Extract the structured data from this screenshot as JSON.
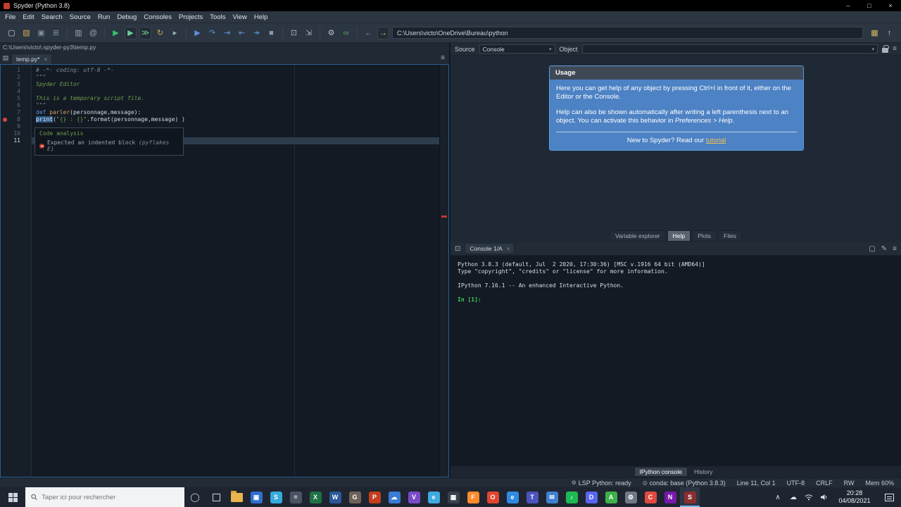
{
  "titlebar": {
    "title": "Spyder (Python 3.8)",
    "minimize_glyph": "–",
    "maximize_glyph": "□",
    "close_glyph": "×"
  },
  "menubar": {
    "items": [
      "File",
      "Edit",
      "Search",
      "Source",
      "Run",
      "Debug",
      "Consoles",
      "Projects",
      "Tools",
      "View",
      "Help"
    ]
  },
  "toolbar": {
    "path_value": "C:\\Users\\victo\\OneDrive\\Bureau\\python",
    "icons": [
      {
        "name": "new-file-icon",
        "g": "▢",
        "c": "#c8d1da"
      },
      {
        "name": "open-file-icon",
        "g": "▧",
        "c": "#d0aa54"
      },
      {
        "name": "save-icon",
        "g": "▣",
        "c": "#7f8da0"
      },
      {
        "name": "save-all-icon",
        "g": "⊞",
        "c": "#7f8da0"
      },
      {
        "sep": true
      },
      {
        "name": "create-cell-icon",
        "g": "▥",
        "c": "#9aa7b5"
      },
      {
        "name": "find-icon",
        "g": "@",
        "c": "#9aa7b5"
      },
      {
        "sep": true
      },
      {
        "name": "run-file-icon",
        "g": "▶",
        "c": "#37c26e"
      },
      {
        "name": "run-cell-icon",
        "g": "▶",
        "c": "#68cf93",
        "boxed": true
      },
      {
        "name": "run-cell-advance-icon",
        "g": "≫",
        "c": "#68cf93",
        "boxed": true
      },
      {
        "name": "rerun-cell-icon",
        "g": "↻",
        "c": "#cfae4a"
      },
      {
        "name": "run-selection-icon",
        "g": "▸",
        "c": "#9ab0c4"
      },
      {
        "sep": true
      },
      {
        "name": "debug-file-icon",
        "g": "▶",
        "c": "#5c8fd6"
      },
      {
        "name": "step-over-icon",
        "g": "↷",
        "c": "#5c8fd6"
      },
      {
        "name": "step-into-icon",
        "g": "⇥",
        "c": "#5c8fd6"
      },
      {
        "name": "step-out-icon",
        "g": "⇤",
        "c": "#5c8fd6"
      },
      {
        "name": "continue-icon",
        "g": "↠",
        "c": "#5c8fd6"
      },
      {
        "name": "stop-icon",
        "g": "■",
        "c": "#8c98a6"
      },
      {
        "sep": true
      },
      {
        "name": "maximize-pane-icon",
        "g": "⊡",
        "c": "#aab4c0"
      },
      {
        "name": "fullscreen-icon",
        "g": "⇲",
        "c": "#aab4c0"
      },
      {
        "sep": true
      },
      {
        "name": "preferences-icon",
        "g": "⚙",
        "c": "#b8c2cc"
      },
      {
        "name": "pythonpath-icon",
        "g": "∞",
        "c": "#58a55c"
      },
      {
        "sep": true
      },
      {
        "name": "back-icon",
        "g": "←",
        "c": "#8c98a6"
      },
      {
        "name": "next-icon",
        "g": "→",
        "c": "#e4c050",
        "boxed": true
      }
    ],
    "right_icons": [
      {
        "name": "browse-working-directory-icon",
        "g": "▦",
        "c": "#d6b75e"
      },
      {
        "name": "parent-directory-icon",
        "g": "↑",
        "c": "#c8d1da"
      }
    ]
  },
  "editor": {
    "breadcrumb": "C:\\Users\\victo\\.spyder-py3\\temp.py",
    "tab_label": "temp.py*",
    "tab_close_glyph": "×",
    "doc_icon_glyph": "▤",
    "menu_glyph": "≡",
    "lines": [
      {
        "n": "1",
        "segs": [
          {
            "c": "comment",
            "t": "# -*- coding: utf-8 -*-"
          }
        ]
      },
      {
        "n": "2",
        "segs": [
          {
            "c": "comment",
            "t": "\"\"\""
          }
        ]
      },
      {
        "n": "3",
        "segs": [
          {
            "c": "docstring",
            "t": "Spyder Editor"
          }
        ]
      },
      {
        "n": "4",
        "segs": []
      },
      {
        "n": "5",
        "segs": [
          {
            "c": "docstring",
            "t": "This is a temporary script file."
          }
        ]
      },
      {
        "n": "6",
        "segs": [
          {
            "c": "comment",
            "t": "\"\"\""
          }
        ]
      },
      {
        "n": "7",
        "segs": [
          {
            "c": "keyword",
            "t": "def "
          },
          {
            "c": "func",
            "t": "parler"
          },
          {
            "c": "plain",
            "t": "(personnage,message):"
          }
        ]
      },
      {
        "n": "8",
        "error": true,
        "segs": [
          {
            "c": "builtin-hl",
            "t": "print"
          },
          {
            "c": "plain",
            "t": "("
          },
          {
            "c": "string",
            "t": "\"{} : {}\""
          },
          {
            "c": "plain",
            "t": ".format(personnage,message) )"
          }
        ]
      },
      {
        "n": "9",
        "segs": []
      },
      {
        "n": "10",
        "segs": []
      },
      {
        "n": "11",
        "current": true,
        "segs": []
      }
    ],
    "tooltip": {
      "title": "Code analysis",
      "message": "Expected an indented block ",
      "detail": "(pyflakes E)"
    }
  },
  "help": {
    "source_label": "Source",
    "source_value": "Console",
    "object_label": "Object",
    "caret_glyph": "▾",
    "menu_glyph": "≡",
    "usage_title": "Usage",
    "p1": "Here you can get help of any object by pressing Ctrl+I in front of it, either on the Editor or the Console.",
    "p2_a": "Help can also be shown automatically after writing a left parenthesis next to an object. You can activate this behavior in ",
    "p2_em": "Preferences > Help",
    "p2_b": ".",
    "p3_a": "New to Spyder? Read our ",
    "p3_link": "tutorial",
    "tabs": [
      "Variable explorer",
      "Help",
      "Plots",
      "Files"
    ],
    "active_tab": "Help"
  },
  "console": {
    "tab_label": "Console 1/A",
    "tab_close_glyph": "×",
    "window_icon_glyph": "⊡",
    "right_icons": [
      {
        "name": "inspect-icon",
        "g": "▢"
      },
      {
        "name": "edit-icon",
        "g": "✎"
      },
      {
        "name": "options-menu-icon",
        "g": "≡"
      }
    ],
    "lines": [
      "Python 3.8.3 (default, Jul  2 2020, 17:30:36) [MSC v.1916 64 bit (AMD64)]",
      "Type \"copyright\", \"credits\" or \"license\" for more information.",
      "",
      "IPython 7.16.1 -- An enhanced Interactive Python.",
      ""
    ],
    "prompt": "In [1]:",
    "tabs": [
      "IPython console",
      "History"
    ],
    "active_tab": "IPython console"
  },
  "statusbar": {
    "items": [
      {
        "icon": "⚙",
        "text": "LSP Python: ready"
      },
      {
        "icon": "◎",
        "text": "conda: base (Python 3.8.3)"
      },
      {
        "text": "Line 11, Col 1"
      },
      {
        "text": "UTF-8"
      },
      {
        "text": "CRLF"
      },
      {
        "text": "RW"
      },
      {
        "text": "Mem 60%"
      }
    ]
  },
  "taskbar": {
    "search_placeholder": "Taper ici pour rechercher",
    "time": "20:28",
    "date": "04/08/2021",
    "tray_chevron_glyph": "∧",
    "tray_cloud_glyph": "☁",
    "apps": [
      {
        "name": "file-explorer",
        "kind": "folder",
        "color": "#eab54e"
      },
      {
        "name": "photos",
        "letter": "▣",
        "color": "#2f6fd0"
      },
      {
        "name": "skype",
        "letter": "S",
        "color": "#35aadc"
      },
      {
        "name": "calculator",
        "letter": "=",
        "color": "#4a5364"
      },
      {
        "name": "excel",
        "letter": "X",
        "color": "#1e7145"
      },
      {
        "name": "word",
        "letter": "W",
        "color": "#2b579a"
      },
      {
        "name": "gimp",
        "letter": "G",
        "color": "#6e6258"
      },
      {
        "name": "powerpoint",
        "letter": "P",
        "color": "#c43e1c"
      },
      {
        "name": "onedrive",
        "letter": "☁",
        "color": "#3a7bd5"
      },
      {
        "name": "visual-studio",
        "letter": "V",
        "color": "#7a4bc8"
      },
      {
        "name": "browser",
        "letter": "e",
        "color": "#3fa9e0"
      },
      {
        "name": "photos-dark",
        "letter": "▦",
        "color": "#39404c"
      },
      {
        "name": "firefox",
        "letter": "F",
        "color": "#ff8a2a"
      },
      {
        "name": "opera",
        "letter": "O",
        "color": "#e0462f"
      },
      {
        "name": "edge",
        "letter": "e",
        "color": "#2f8ae0"
      },
      {
        "name": "teams",
        "letter": "T",
        "color": "#4b53bc"
      },
      {
        "name": "mail",
        "letter": "✉",
        "color": "#3f7fd0"
      },
      {
        "name": "spotify",
        "letter": "♪",
        "color": "#1db954"
      },
      {
        "name": "discord",
        "letter": "D",
        "color": "#5865f2"
      },
      {
        "name": "anaconda",
        "letter": "A",
        "color": "#3eb049"
      },
      {
        "name": "settings",
        "letter": "⚙",
        "color": "#707a86"
      },
      {
        "name": "chrome",
        "letter": "C",
        "color": "#e04a3f"
      },
      {
        "name": "onenote",
        "letter": "N",
        "color": "#7719aa"
      },
      {
        "name": "spyder",
        "letter": "S",
        "color": "#8b2e2e",
        "active": true
      }
    ]
  }
}
